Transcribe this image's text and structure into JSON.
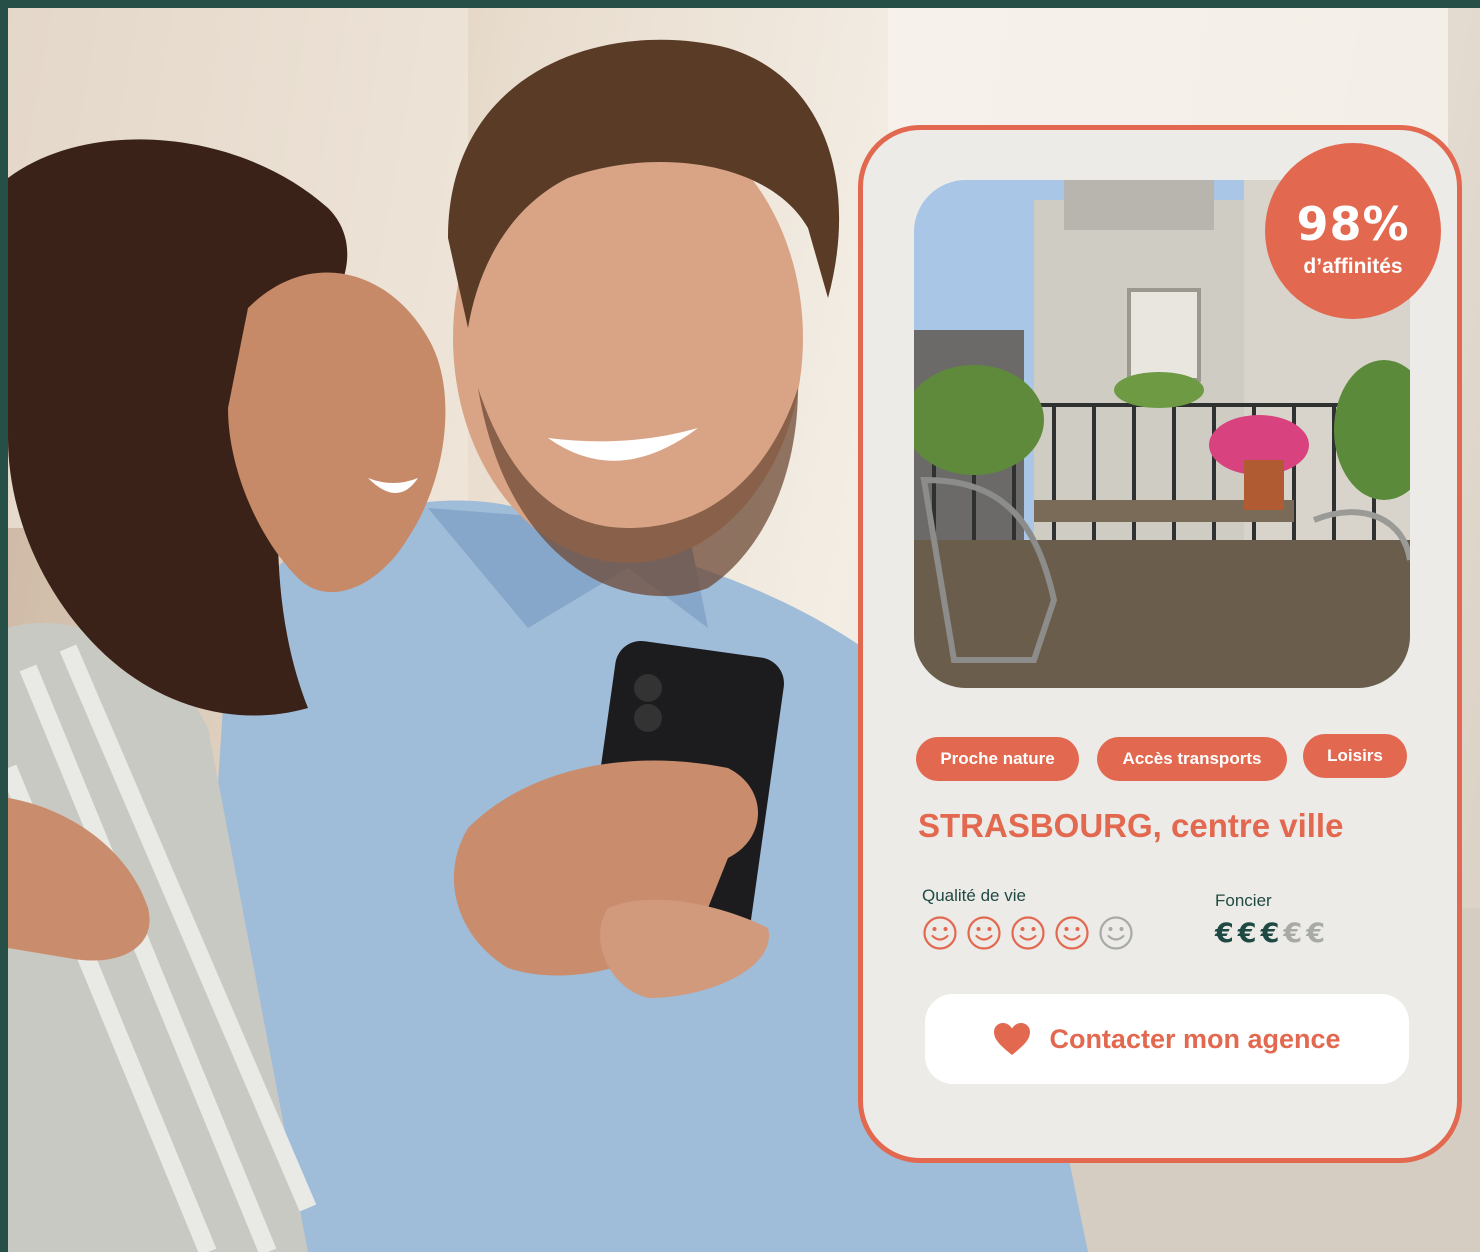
{
  "card": {
    "affinity": {
      "value": "98%",
      "label": "d’affinités"
    },
    "tags": [
      "Proche nature",
      "Accès transports",
      "Loisirs"
    ],
    "location": "STRASBOURG, centre ville",
    "quality": {
      "label": "Qualité de vie",
      "rating": 4,
      "max": 5
    },
    "land": {
      "label": "Foncier",
      "level": 3,
      "max": 5,
      "symbol": "€"
    },
    "cta": {
      "label": "Contacter mon agence",
      "icon": "heart-icon"
    }
  },
  "colors": {
    "accent": "#e2694f",
    "dark_green": "#1f4a43",
    "frame": "#264f48",
    "card_bg": "#ecebe8",
    "muted": "#a8aaa6"
  }
}
